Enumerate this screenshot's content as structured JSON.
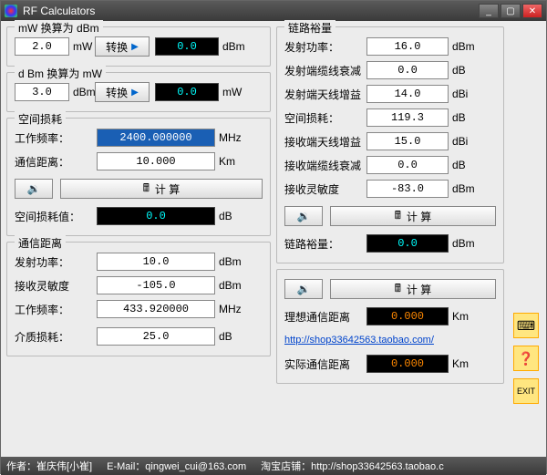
{
  "window": {
    "title": "RF Calculators"
  },
  "conv1": {
    "legend": "mW 换算为 dBm",
    "input": "2.0",
    "in_unit": "mW",
    "btn": "转换",
    "out": "0.0",
    "out_unit": "dBm"
  },
  "conv2": {
    "legend": "d Bm 换算为 mW",
    "input": "3.0",
    "in_unit": "dBm",
    "btn": "转换",
    "out": "0.0",
    "out_unit": "mW"
  },
  "pathloss": {
    "legend": "空间损耗",
    "freq_label": "工作频率：",
    "freq": "2400.000000",
    "freq_unit": "MHz",
    "dist_label": "通信距离：",
    "dist": "10.000",
    "dist_unit": "Km",
    "calc_btn": "计  算",
    "result_label": "空间损耗值：",
    "result": "0.0",
    "result_unit": "dB"
  },
  "commdist": {
    "legend": "通信距离",
    "tx_label": "发射功率：",
    "tx": "10.0",
    "tx_unit": "dBm",
    "rx_label": "接收灵敏度",
    "rx": "-105.0",
    "rx_unit": "dBm",
    "freq_label": "工作频率：",
    "freq": "433.920000",
    "freq_unit": "MHz",
    "med_label": "介质损耗：",
    "med": "25.0",
    "med_unit": "dB"
  },
  "link": {
    "legend": "链路裕量",
    "tx_label": "发射功率：",
    "tx": "16.0",
    "tx_unit": "dBm",
    "txcable_label": "发射端缆线衰减",
    "txcable": "0.0",
    "txcable_unit": "dB",
    "txant_label": "发射端天线增益",
    "txant": "14.0",
    "txant_unit": "dBi",
    "space_label": "空间损耗：",
    "space": "119.3",
    "space_unit": "dB",
    "rxant_label": "接收端天线增益",
    "rxant": "15.0",
    "rxant_unit": "dBi",
    "rxcable_label": "接收端缆线衰减",
    "rxcable": "0.0",
    "rxcable_unit": "dB",
    "rxsen_label": "接收灵敏度",
    "rxsen": "-83.0",
    "rxsen_unit": "dBm",
    "calc_btn": "计  算",
    "margin_label": "链路裕量：",
    "margin": "0.0",
    "margin_unit": "dBm"
  },
  "right2": {
    "calc_btn": "计  算",
    "ideal_label": "理想通信距离",
    "ideal": "0.000",
    "ideal_unit": "Km",
    "url": "http://shop33642563.taobao.com/",
    "real_label": "实际通信距离",
    "real": "0.000",
    "real_unit": "Km"
  },
  "status": {
    "author_lbl": "作者：",
    "author": "崔庆伟[小崔]",
    "email_lbl": "E-Mail：",
    "email": "qingwei_cui@163.com",
    "shop_lbl": "淘宝店铺：",
    "shop": "http://shop33642563.taobao.c"
  }
}
